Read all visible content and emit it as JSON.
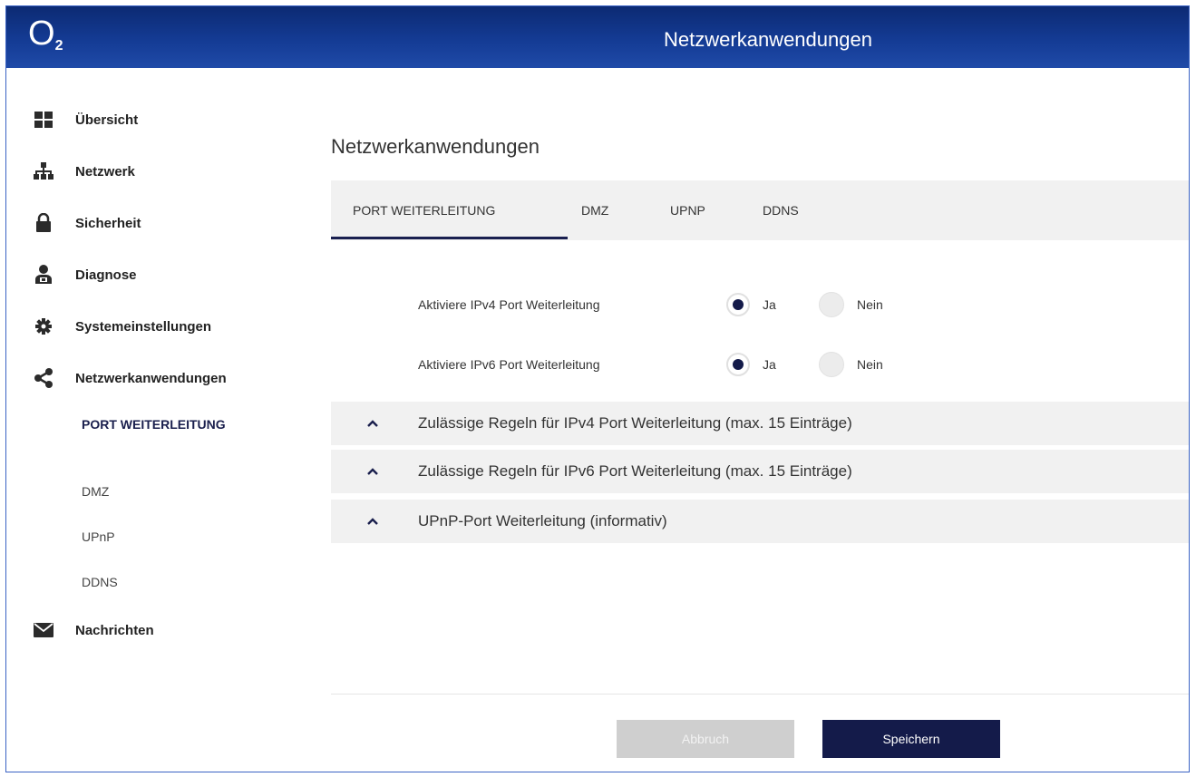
{
  "header": {
    "logo_main": "O",
    "logo_sub": "2",
    "title": "Netzwerkanwendungen"
  },
  "sidebar": {
    "items": [
      {
        "label": "Übersicht",
        "icon": "grid-icon"
      },
      {
        "label": "Netzwerk",
        "icon": "network-icon"
      },
      {
        "label": "Sicherheit",
        "icon": "lock-icon"
      },
      {
        "label": "Diagnose",
        "icon": "user-diagnose-icon"
      },
      {
        "label": "Systemeinstellungen",
        "icon": "gear-icon"
      },
      {
        "label": "Netzwerkanwendungen",
        "icon": "share-icon"
      },
      {
        "label": "Nachrichten",
        "icon": "envelope-icon"
      }
    ],
    "subitems": [
      {
        "label": "PORT WEITERLEITUNG",
        "active": true
      },
      {
        "label": "DMZ",
        "active": false
      },
      {
        "label": "UPnP",
        "active": false
      },
      {
        "label": "DDNS",
        "active": false
      }
    ]
  },
  "main": {
    "title": "Netzwerkanwendungen",
    "tabs": [
      {
        "label": "PORT WEITERLEITUNG",
        "active": true
      },
      {
        "label": "DMZ",
        "active": false
      },
      {
        "label": "UPNP",
        "active": false
      },
      {
        "label": "DDNS",
        "active": false
      }
    ],
    "radios": [
      {
        "label": "Aktiviere IPv4 Port Weiterleitung",
        "yes": "Ja",
        "no": "Nein",
        "selected": "Ja"
      },
      {
        "label": "Aktiviere IPv6 Port Weiterleitung",
        "yes": "Ja",
        "no": "Nein",
        "selected": "Ja"
      }
    ],
    "accordions": [
      {
        "label": "Zulässige Regeln für IPv4 Port Weiterleitung (max. 15 Einträge)"
      },
      {
        "label": "Zulässige Regeln für IPv6 Port Weiterleitung (max. 15 Einträge)"
      },
      {
        "label": "UPnP-Port Weiterleitung (informativ)"
      }
    ],
    "buttons": {
      "cancel": "Abbruch",
      "save": "Speichern"
    }
  },
  "colors": {
    "header": "#143b94",
    "accent": "#141b4a",
    "tab_bg": "#f1f1f1",
    "disabled": "#cfcfcf"
  }
}
